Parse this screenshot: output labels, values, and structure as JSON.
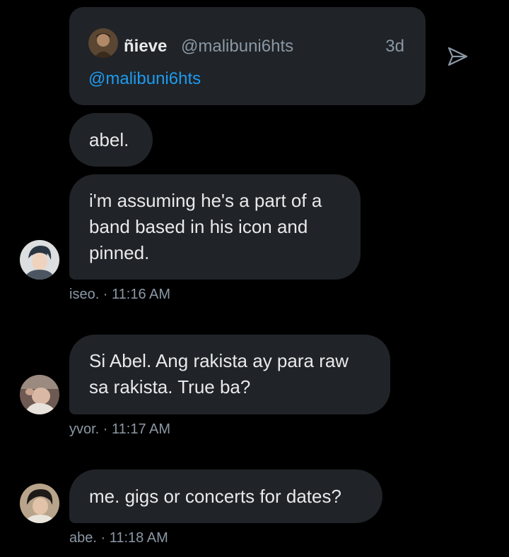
{
  "shared_tweet": {
    "author_name": "ñieve",
    "author_handle": "@malibuni6hts",
    "time": "3d",
    "body": "@malibuni6hts"
  },
  "icons": {
    "share": "send-icon"
  },
  "messages": [
    {
      "text": "abel."
    },
    {
      "text": "i'm assuming he's a part of a band based in his icon and pinned.",
      "sender": "iseo.",
      "time": "11:16 AM"
    },
    {
      "text": "Si Abel. Ang rakista ay para raw sa rakista. True ba?",
      "sender": "yvor.",
      "time": "11:17 AM"
    },
    {
      "text": "me. gigs or concerts for dates?",
      "sender": "abe.",
      "time": "11:18 AM"
    }
  ],
  "meta_separator": " · ",
  "colors": {
    "background": "#000000",
    "bubble": "#202327",
    "text": "#e7e9ea",
    "secondary": "#8b98a5",
    "link": "#1d9bf0"
  }
}
